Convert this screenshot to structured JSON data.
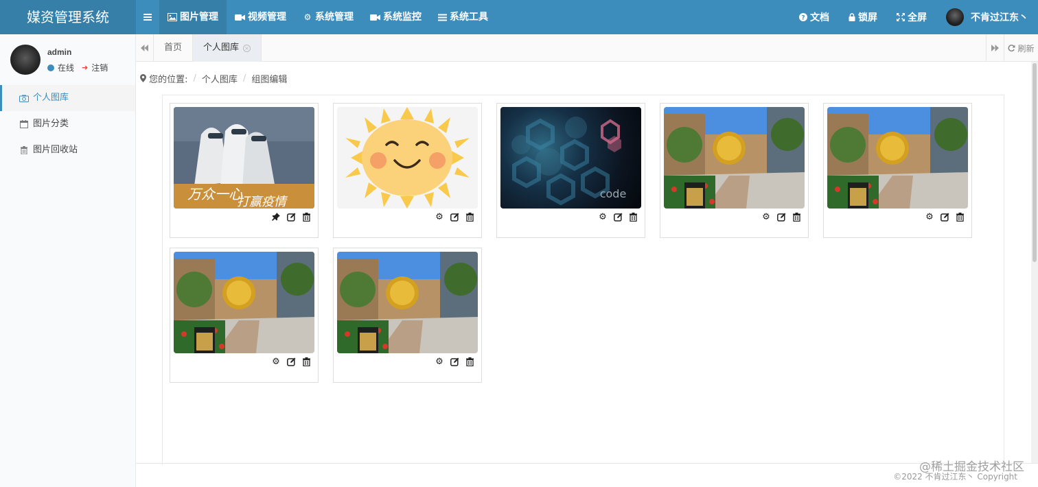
{
  "app": {
    "title": "媒资管理系统"
  },
  "topnav": {
    "toggle_icon": "menu-icon",
    "items": [
      {
        "label": "图片管理",
        "icon": "image-icon",
        "active": true
      },
      {
        "label": "视频管理",
        "icon": "video-icon"
      },
      {
        "label": "系统管理",
        "icon": "gear-icon"
      },
      {
        "label": "系统监控",
        "icon": "video-icon"
      },
      {
        "label": "系统工具",
        "icon": "list-icon"
      }
    ],
    "right": [
      {
        "label": "文档",
        "icon": "question-icon"
      },
      {
        "label": "锁屏",
        "icon": "lock-icon"
      },
      {
        "label": "全屏",
        "icon": "fullscreen-icon"
      }
    ],
    "user": "不肯过江东丶"
  },
  "sidebar": {
    "user": {
      "name": "admin",
      "status": "在线",
      "logout": "注销"
    },
    "items": [
      {
        "label": "个人图库",
        "icon": "camera-icon",
        "active": true
      },
      {
        "label": "图片分类",
        "icon": "calendar-icon"
      },
      {
        "label": "图片回收站",
        "icon": "trash-icon"
      }
    ]
  },
  "tabs": {
    "items": [
      {
        "label": "首页"
      },
      {
        "label": "个人图库",
        "active": true
      }
    ],
    "refresh": "刷新"
  },
  "breadcrumb": {
    "prefix": "您的位置:",
    "items": [
      "个人图库",
      "组图编辑"
    ]
  },
  "gallery": [
    {
      "image": "doctors-poster",
      "actions": [
        "pin-icon",
        "edit-icon",
        "trash-icon"
      ]
    },
    {
      "image": "sun-illustration",
      "actions": [
        "gear-icon",
        "edit-icon",
        "trash-icon"
      ]
    },
    {
      "image": "dark-hexagon-code",
      "actions": [
        "gear-icon",
        "edit-icon",
        "trash-icon"
      ]
    },
    {
      "image": "plaza-photo",
      "actions": [
        "gear-icon",
        "edit-icon",
        "trash-icon"
      ]
    },
    {
      "image": "plaza-photo",
      "actions": [
        "gear-icon",
        "edit-icon",
        "trash-icon"
      ]
    },
    {
      "image": "plaza-photo",
      "actions": [
        "gear-icon",
        "edit-icon",
        "trash-icon"
      ]
    },
    {
      "image": "plaza-photo",
      "actions": [
        "gear-icon",
        "edit-icon",
        "trash-icon"
      ]
    }
  ],
  "footer": {
    "copyright": "©2022 不肯过江东丶 Copyright"
  },
  "watermark": "@稀土掘金技术社区",
  "colors": {
    "primary": "#3c8dbc",
    "primary_dark": "#367fa9",
    "sidebar_bg": "#f9fafc"
  }
}
